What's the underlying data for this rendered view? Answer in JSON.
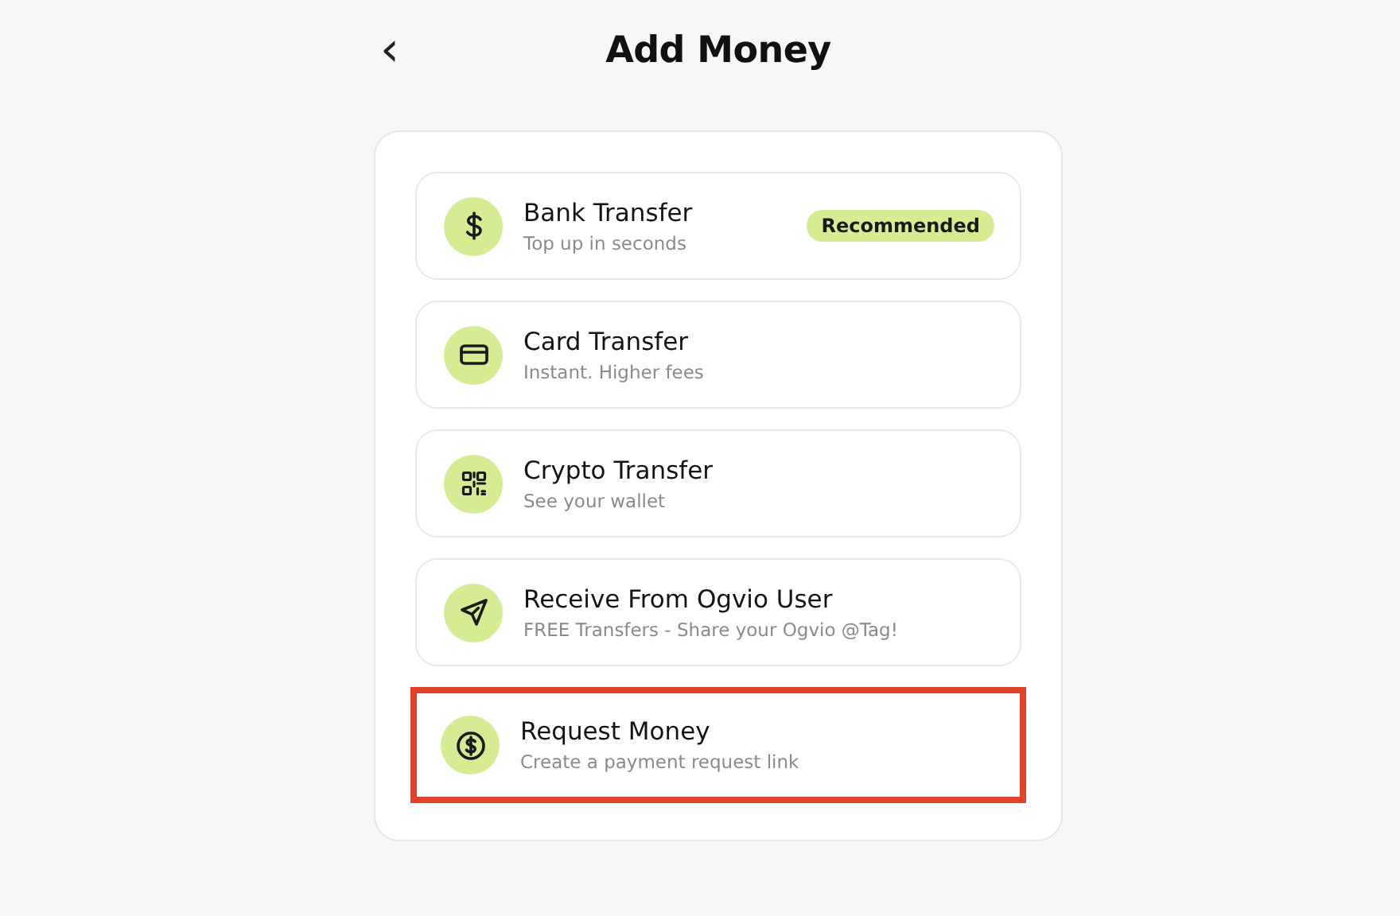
{
  "header": {
    "back": "‹",
    "title": "Add Money"
  },
  "options": [
    {
      "kind": "bank",
      "title": "Bank Transfer",
      "subtitle": "Top up in seconds",
      "badge": "Recommended",
      "highlighted": false
    },
    {
      "kind": "card",
      "title": "Card Transfer",
      "subtitle": "Instant. Higher fees",
      "highlighted": false
    },
    {
      "kind": "crypto",
      "title": "Crypto Transfer",
      "subtitle": "See your wallet",
      "highlighted": false
    },
    {
      "kind": "send",
      "title": "Receive From Ogvio User",
      "subtitle": "FREE Transfers - Share your Ogvio @Tag!",
      "highlighted": false
    },
    {
      "kind": "request",
      "title": "Request Money",
      "subtitle": "Create a payment request link",
      "highlighted": true
    }
  ]
}
